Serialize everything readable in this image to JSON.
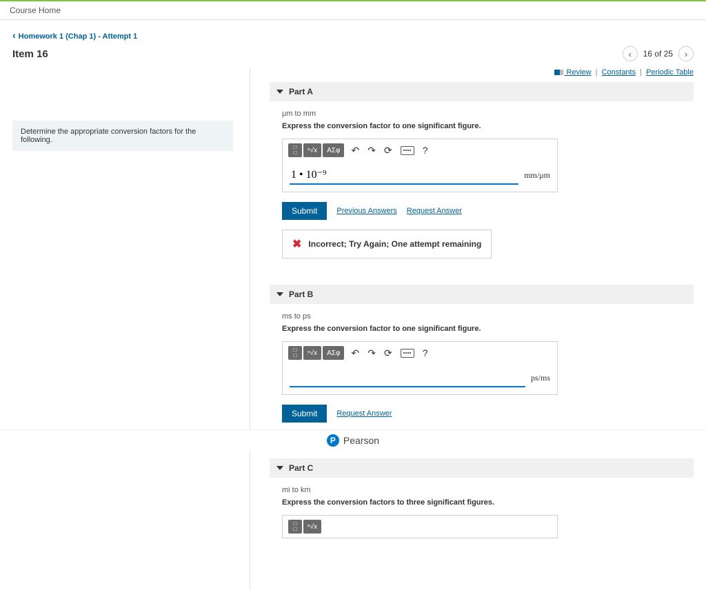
{
  "topbar": {
    "course_home": "Course Home"
  },
  "breadcrumb": "Homework 1 (Chap 1) - Attempt 1",
  "item": {
    "title": "Item 16",
    "position": "16 of 25"
  },
  "resources": {
    "review": " Review",
    "constants": "Constants",
    "ptable": "Periodic Table"
  },
  "prompt": "Determine the appropriate conversion factors for the following.",
  "toolbar": {
    "symbols_label": "ΑΣφ",
    "help_label": "?"
  },
  "actions": {
    "submit": "Submit",
    "previous": "Previous Answers",
    "request": "Request Answer"
  },
  "partA": {
    "header": "Part A",
    "conversion": "μm to mm",
    "instruction": "Express the conversion factor to one significant figure.",
    "answer_value": "1 • 10⁻⁹",
    "units": "mm/μm",
    "feedback": "Incorrect; Try Again; One attempt remaining"
  },
  "partB": {
    "header": "Part B",
    "conversion": "ms to ps",
    "instruction": "Express the conversion factor to one significant figure.",
    "answer_value": "",
    "units": "ps/ms"
  },
  "partC": {
    "header": "Part C",
    "conversion": "mi to km",
    "instruction": "Express the conversion factors to three significant figures."
  },
  "footer": {
    "brand": "Pearson"
  }
}
